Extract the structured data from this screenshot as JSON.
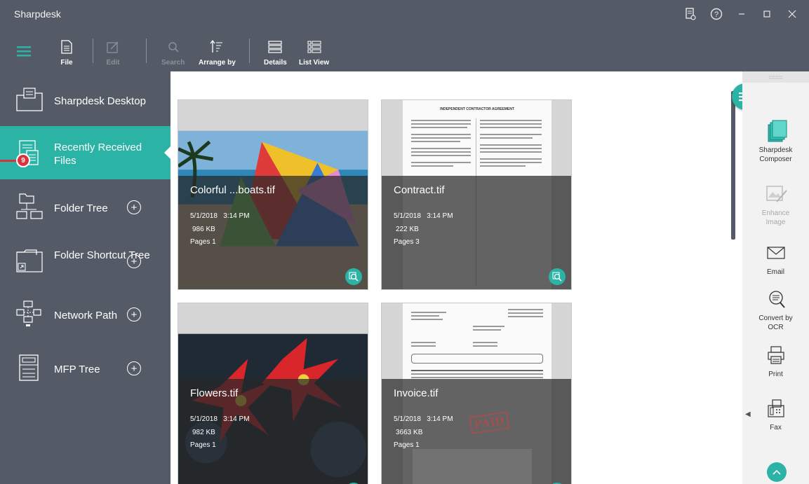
{
  "window": {
    "title": "Sharpdesk"
  },
  "toolbar": {
    "file": "File",
    "edit": "Edit",
    "search": "Search",
    "arrange_by": "Arrange by",
    "details": "Details",
    "list_view": "List View"
  },
  "sidebar": {
    "items": [
      {
        "label": "Sharpdesk Desktop"
      },
      {
        "label": "Recently Received Files",
        "badge": "9"
      },
      {
        "label": "Folder Tree"
      },
      {
        "label": "Folder Shortcut Tree"
      },
      {
        "label": "Network Path"
      },
      {
        "label": "MFP Tree"
      }
    ]
  },
  "files": [
    {
      "name": "Colorful ...boats.tif",
      "date": "5/1/2018",
      "time": "3:14 PM",
      "size": "986 KB",
      "pages": "Pages 1"
    },
    {
      "name": "Contract.tif",
      "date": "5/1/2018",
      "time": "3:14 PM",
      "size": "222 KB",
      "pages": "Pages 3"
    },
    {
      "name": "Flowers.tif",
      "date": "5/1/2018",
      "time": "3:14 PM",
      "size": "982 KB",
      "pages": "Pages 1"
    },
    {
      "name": "Invoice.tif",
      "date": "5/1/2018",
      "time": "3:14 PM",
      "size": "3663 KB",
      "pages": "Pages 1"
    }
  ],
  "doc_texts": {
    "contract_heading": "INDEPENDENT CONTRACTOR AGREEMENT",
    "paid_stamp": "PAID"
  },
  "right_panel": {
    "composer": "Sharpdesk Composer",
    "enhance": "Enhance Image",
    "email": "Email",
    "ocr": "Convert by OCR",
    "print": "Print",
    "fax": "Fax"
  },
  "colors": {
    "accent": "#2bb3a6",
    "chrome": "#555b66",
    "badge": "#d9343b"
  }
}
